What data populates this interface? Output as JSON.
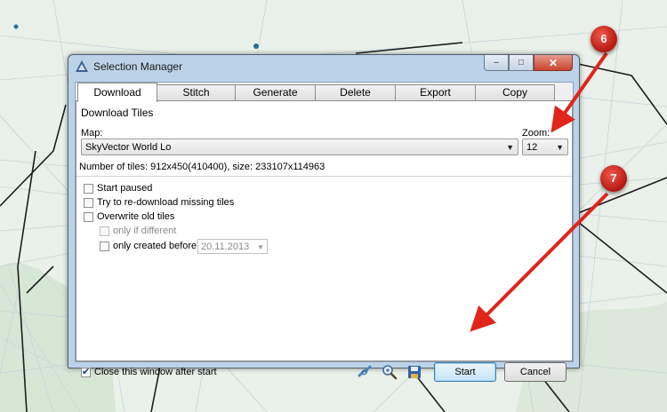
{
  "window": {
    "title": "Selection Manager",
    "controls": {
      "minimize": "–",
      "maximize": "□",
      "close": "✕"
    }
  },
  "tabs": [
    {
      "label": "Download",
      "active": true
    },
    {
      "label": "Stitch"
    },
    {
      "label": "Generate"
    },
    {
      "label": "Delete"
    },
    {
      "label": "Export"
    },
    {
      "label": "Copy"
    }
  ],
  "download": {
    "section_title": "Download Tiles",
    "map_label": "Map:",
    "map_value": "SkyVector World Lo",
    "zoom_label": "Zoom:",
    "zoom_value": "12",
    "tiles_info": "Number of tiles: 912x450(410400), size: 233107x114963",
    "options": {
      "start_paused": {
        "label": "Start paused",
        "checked": false
      },
      "redownload_missing": {
        "label": "Try to re-download missing tiles",
        "checked": false
      },
      "overwrite_old": {
        "label": "Overwrite old tiles",
        "checked": false
      },
      "only_if_different": {
        "label": "only if different",
        "checked": false
      },
      "only_created_before": {
        "label": "only created before",
        "checked": false
      }
    },
    "date_value": "20.11.2013"
  },
  "footer": {
    "close_after_start": {
      "label": "Close this window after start",
      "checked": true
    },
    "icons": [
      "link-icon",
      "zoom-icon",
      "save-icon"
    ],
    "start_label": "Start",
    "cancel_label": "Cancel"
  },
  "annotations": {
    "marker_6": "6",
    "marker_7": "7",
    "color": "#e0251b"
  }
}
